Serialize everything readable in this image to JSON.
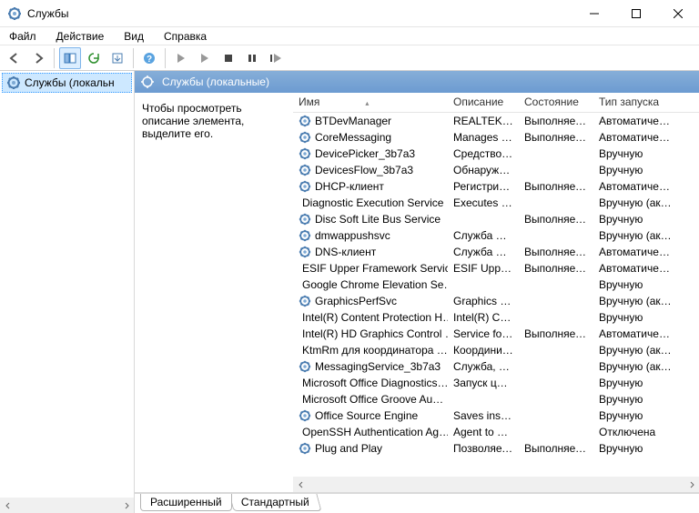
{
  "window": {
    "title": "Службы"
  },
  "menu": {
    "file": "Файл",
    "action": "Действие",
    "view": "Вид",
    "help": "Справка"
  },
  "leftPanel": {
    "item": "Службы (локальн"
  },
  "listHeader": {
    "title": "Службы (локальные)"
  },
  "detail": {
    "hint": "Чтобы просмотреть описание элемента, выделите его."
  },
  "columns": {
    "name": "Имя",
    "desc": "Описание",
    "state": "Состояние",
    "startup": "Тип запуска"
  },
  "tabs": {
    "extended": "Расширенный",
    "standard": "Стандартный"
  },
  "services": [
    {
      "name": "BTDevManager",
      "desc": "REALTEK Bl…",
      "state": "Выполняется",
      "startup": "Автоматичес…"
    },
    {
      "name": "CoreMessaging",
      "desc": "Manages c…",
      "state": "Выполняется",
      "startup": "Автоматичес…"
    },
    {
      "name": "DevicePicker_3b7a3",
      "desc": "Средство в…",
      "state": "",
      "startup": "Вручную"
    },
    {
      "name": "DevicesFlow_3b7a3",
      "desc": "Обнаруже…",
      "state": "",
      "startup": "Вручную"
    },
    {
      "name": "DHCP-клиент",
      "desc": "Регистриру…",
      "state": "Выполняется",
      "startup": "Автоматичес…"
    },
    {
      "name": "Diagnostic Execution Service",
      "desc": "Executes di…",
      "state": "",
      "startup": "Вручную (ак…"
    },
    {
      "name": "Disc Soft Lite Bus Service",
      "desc": "",
      "state": "Выполняется",
      "startup": "Вручную"
    },
    {
      "name": "dmwappushsvc",
      "desc": "Служба ма…",
      "state": "",
      "startup": "Вручную (ак…"
    },
    {
      "name": "DNS-клиент",
      "desc": "Служба D…",
      "state": "Выполняется",
      "startup": "Автоматичес…"
    },
    {
      "name": "ESIF Upper Framework Service",
      "desc": "ESIF Upper …",
      "state": "Выполняется",
      "startup": "Автоматичес…"
    },
    {
      "name": "Google Chrome Elevation Se…",
      "desc": "",
      "state": "",
      "startup": "Вручную"
    },
    {
      "name": "GraphicsPerfSvc",
      "desc": "Graphics p…",
      "state": "",
      "startup": "Вручную (ак…"
    },
    {
      "name": "Intel(R) Content Protection H…",
      "desc": "Intel(R) Con…",
      "state": "",
      "startup": "Вручную"
    },
    {
      "name": "Intel(R) HD Graphics Control …",
      "desc": "Service for I…",
      "state": "Выполняется",
      "startup": "Автоматичес…"
    },
    {
      "name": "KtmRm для координатора …",
      "desc": "Координи…",
      "state": "",
      "startup": "Вручную (ак…"
    },
    {
      "name": "MessagingService_3b7a3",
      "desc": "Служба, от…",
      "state": "",
      "startup": "Вручную (ак…"
    },
    {
      "name": "Microsoft Office Diagnostics…",
      "desc": "Запуск цен…",
      "state": "",
      "startup": "Вручную"
    },
    {
      "name": "Microsoft Office Groove Au…",
      "desc": "",
      "state": "",
      "startup": "Вручную"
    },
    {
      "name": "Office  Source Engine",
      "desc": "Saves instal…",
      "state": "",
      "startup": "Вручную"
    },
    {
      "name": "OpenSSH Authentication Ag…",
      "desc": "Agent to h…",
      "state": "",
      "startup": "Отключена"
    },
    {
      "name": "Plug and Play",
      "desc": "Позволяет …",
      "state": "Выполняется",
      "startup": "Вручную"
    }
  ]
}
